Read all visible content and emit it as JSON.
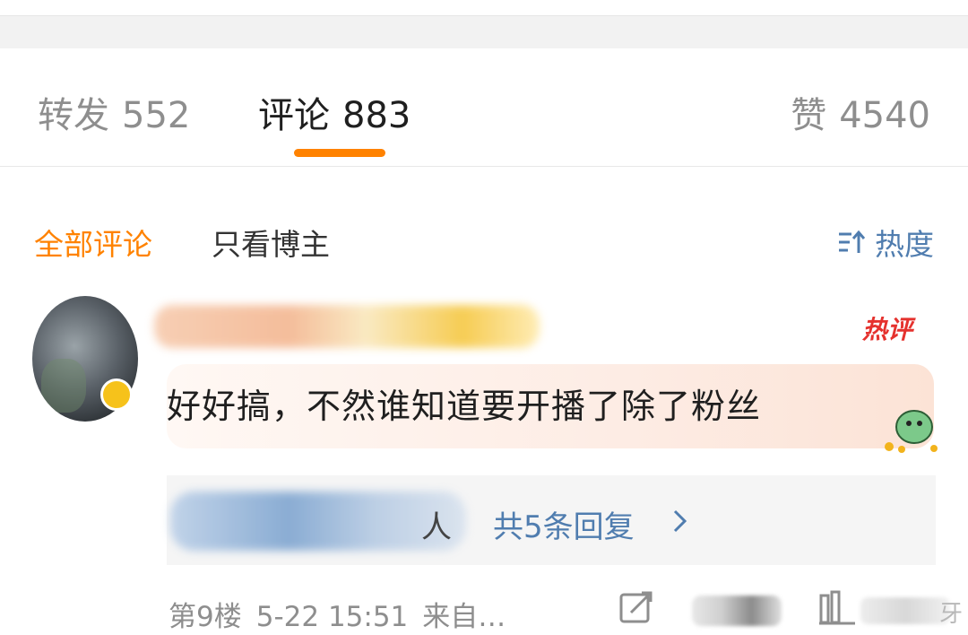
{
  "tabs": {
    "repost": {
      "label": "转发",
      "count": "552"
    },
    "comment": {
      "label": "评论",
      "count": "883"
    },
    "like": {
      "label": "赞",
      "count": "4540"
    }
  },
  "filters": {
    "all": "全部评论",
    "owner_only": "只看博主",
    "sort": "热度",
    "sort_icon": "sort-icon"
  },
  "comment": {
    "hot_badge": "热评",
    "text": "好好搞，不然谁知道要开播了除了粉丝",
    "reply_who": "人",
    "reply_link": "共5条回复",
    "floor": "第9楼",
    "time": "5-22 15:51",
    "source": "来自…"
  },
  "actions": {
    "more_char": "牙"
  },
  "colors": {
    "accent": "#ff8200",
    "link": "#507daf",
    "hot": "#e5322e"
  }
}
